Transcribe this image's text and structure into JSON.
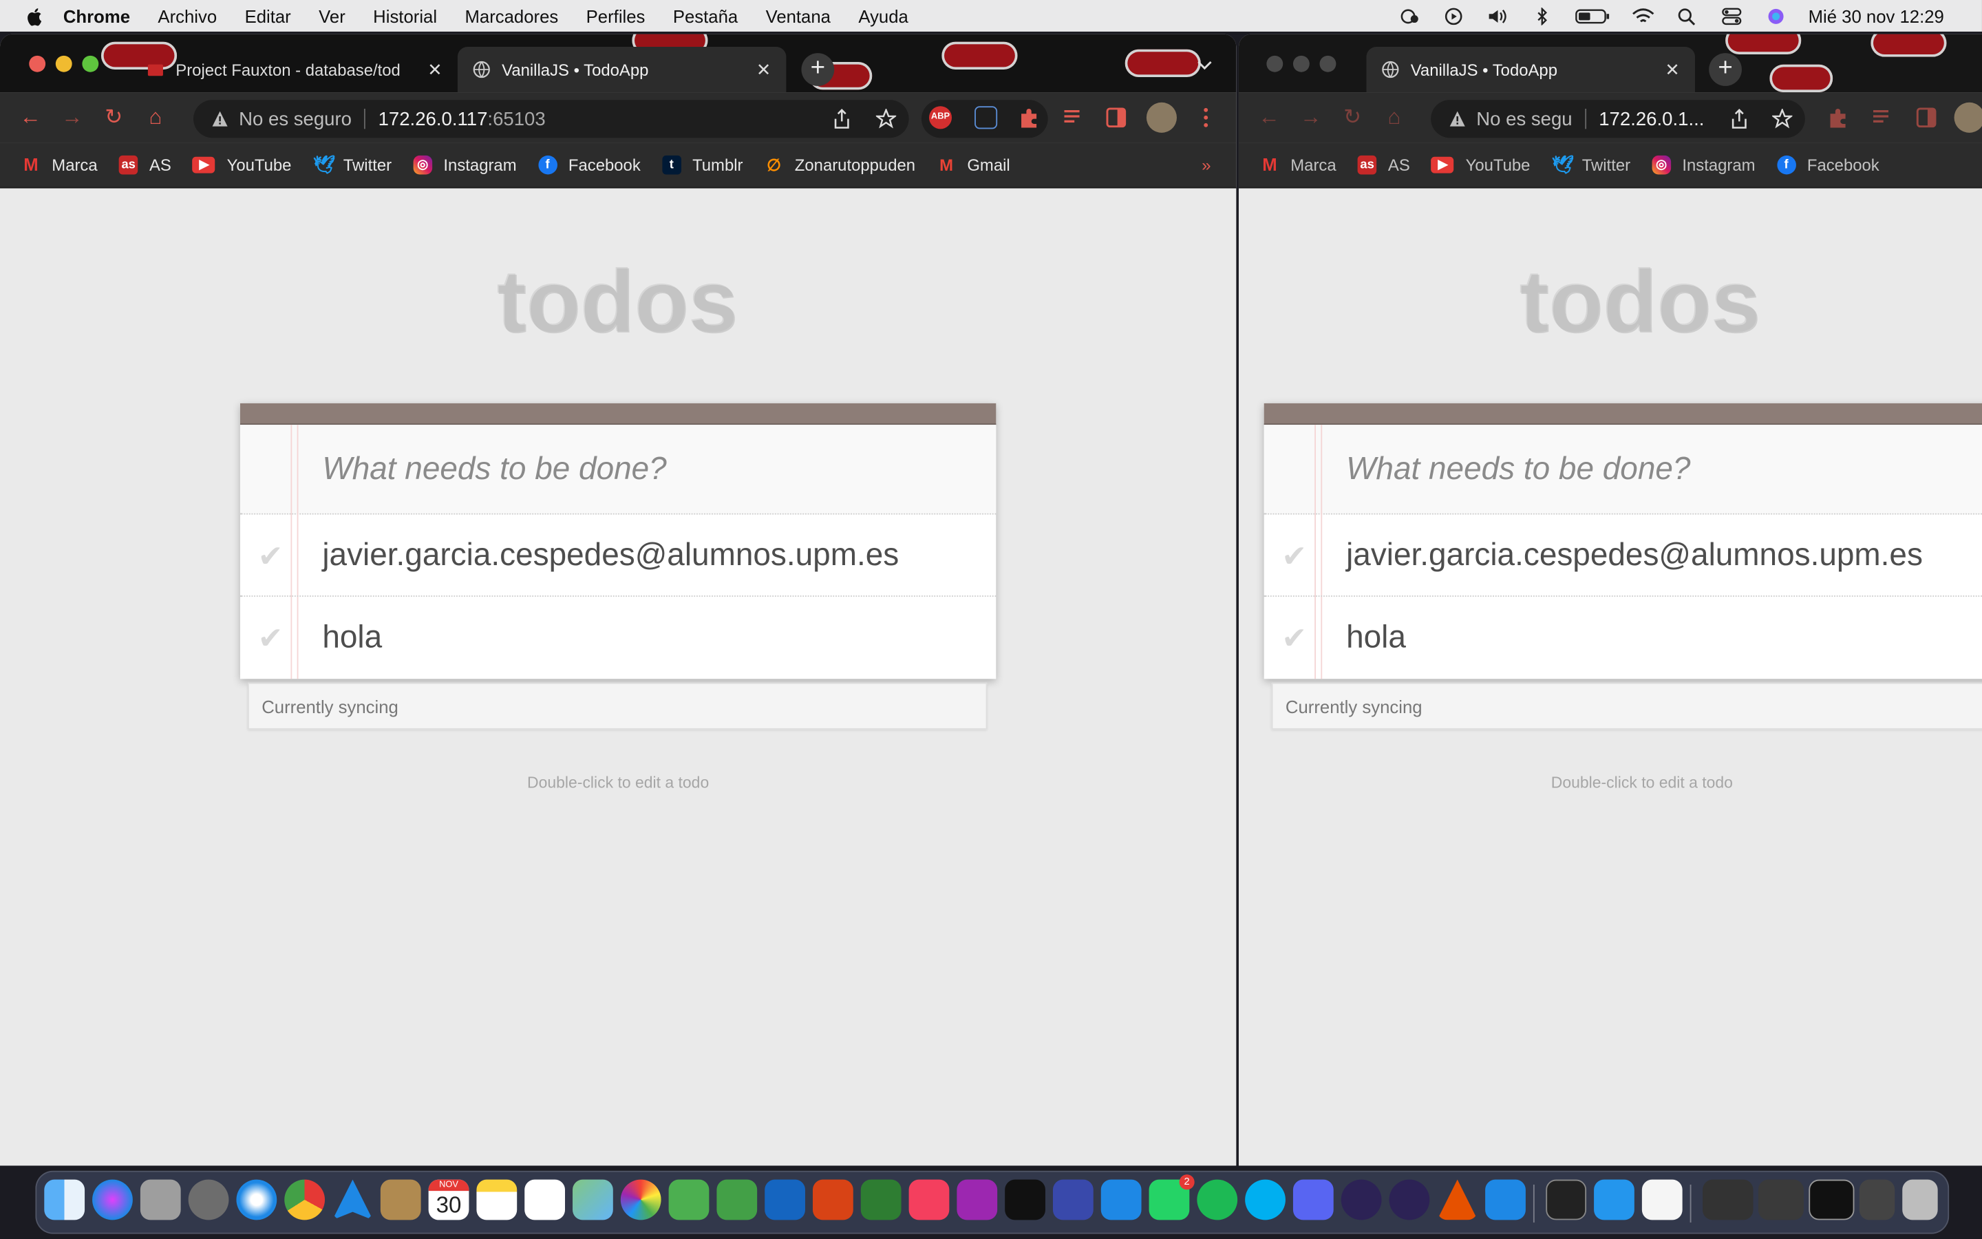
{
  "menubar": {
    "app": "Chrome",
    "items": [
      "Archivo",
      "Editar",
      "Ver",
      "Historial",
      "Marcadores",
      "Perfiles",
      "Pestaña",
      "Ventana",
      "Ayuda"
    ],
    "clock": "Mié 30 nov 12:29"
  },
  "left_window": {
    "tabs": [
      {
        "title": "Project Fauxton - database/tod",
        "close": "✕"
      },
      {
        "title": "VanillaJS • TodoApp",
        "close": "✕"
      }
    ],
    "omnibox": {
      "insecure_label": "No es seguro",
      "host": "172.26.0.117",
      "port": ":65103"
    },
    "bookmarks": [
      "Marca",
      "AS",
      "YouTube",
      "Twitter",
      "Instagram",
      "Facebook",
      "Tumblr",
      "Zonarutoppuden",
      "Gmail"
    ],
    "bookmarks_more": "»"
  },
  "right_window": {
    "tabs": [
      {
        "title": "VanillaJS • TodoApp",
        "close": "✕"
      }
    ],
    "omnibox": {
      "insecure_label": "No es segu",
      "host": "172.26.0.1..."
    },
    "bookmarks": [
      "Marca",
      "AS",
      "YouTube",
      "Twitter",
      "Instagram",
      "Facebook"
    ]
  },
  "todo_app": {
    "title": "todos",
    "new_todo_placeholder": "What needs to be done?",
    "items": [
      {
        "label": "javier.garcia.cespedes@alumnos.upm.es",
        "check": "✔"
      },
      {
        "label": "hola",
        "check": "✔"
      }
    ],
    "sync_status": "Currently syncing",
    "info": "Double-click to edit a todo"
  },
  "dock": {
    "calendar_month": "NOV",
    "calendar_day": "30",
    "whatsapp_badge": "2"
  },
  "colors": {
    "header_bar": "#8d7d77",
    "accent_red": "#e05a50",
    "todo_text": "#4d4d4d"
  }
}
